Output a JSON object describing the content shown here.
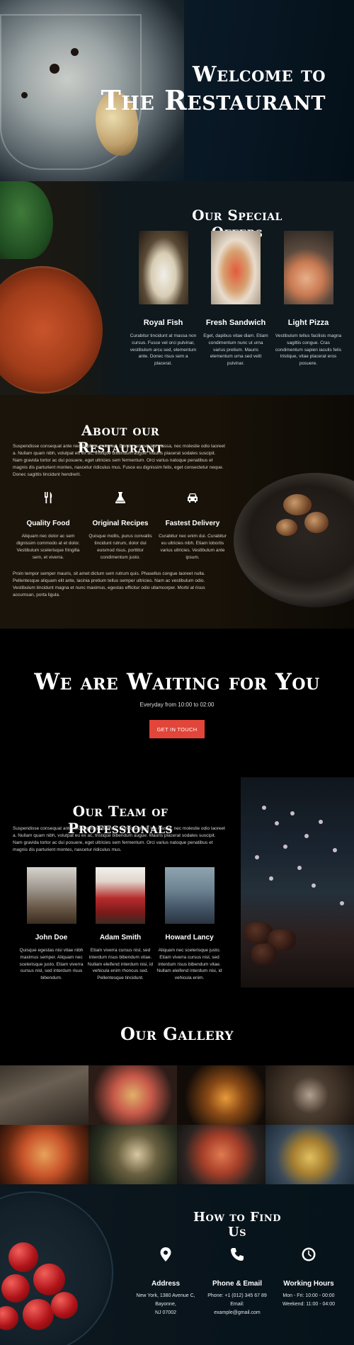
{
  "hero": {
    "title_line1": "Welcome to",
    "title_line2": "The Restaurant"
  },
  "offers": {
    "title": "Our Special Offers",
    "items": [
      {
        "name": "Royal Fish",
        "text": "Curabitur tincidunt at massa non cursus. Fusce vel orci pulvinar, vestibulum arcu sed, elementum ante. Donec risus sem a placerat."
      },
      {
        "name": "Fresh Sandwich",
        "text": "Eget, dapibus vitae diam. Etiam condimentum nunc ut urna varius pretium. Mauris elementum urna sed velit pulvinar."
      },
      {
        "name": "Light Pizza",
        "text": "Vestibulum tellus facilisis magna sagittis congue. Cras condimentum sapien iaculis felis tristique, vitae placerat eros posuere."
      }
    ]
  },
  "about": {
    "title": "About our Restaurant",
    "intro": "Suspendisse consequat ante nec dapibus euismod. Donec semper leo massa, nec molestie odio laoreet a. Nullam quam nibh, volutpat eu ex ac, tristique bibendum augue. Mauris placerat sodales suscipit. Nam gravida tortor ac dui posuere, eget ultricies sem fermentum. Orci varius natoque penatibus et magnis dis parturient montes, nascetur ridiculus mus. Fusce eu dignissim felis, eget consectetur neque. Donec sagittis tincidunt hendrerit.",
    "features": [
      {
        "icon": "utensils-icon",
        "name": "Quality Food",
        "text": "Aliquam nec dolor ac sem dignissim commodo at et dolor. Vestibulum scelerisque fringilla sem, et viverra."
      },
      {
        "icon": "flask-icon",
        "name": "Original Recipes",
        "text": "Quisque mollis, purus convallis tincidunt rutrum, dolor dui euismod risus, porttitor condimentum justo."
      },
      {
        "icon": "car-icon",
        "name": "Fastest Delivery",
        "text": "Curabitur nec enim dui. Curabitur eu ultricies nibh. Etiam lobortis varius ultricies. Vestibulum ante ipsum."
      }
    ],
    "outro": "Proin tempor semper mauris, sit amet dictum sem rutrum quis. Phasellus congue laoreet nulla. Pellentesque aliquam elit ante, lacinia pretium tellus semper ultricies. Nam ac vestibulum odio. Vestibulum tincidunt magna et nunc maximus, egestas efficitur odio ullamcorper. Morbi at risus accumsan, porta ligula."
  },
  "waiting": {
    "title": "We are Waiting for You",
    "hours": "Everyday from 10:00 to 02:00",
    "cta_label": "GET IN TOUCH"
  },
  "team": {
    "title": "Our Team of Professionals",
    "intro": "Suspendisse consequat ante nec dapibus euismod. Donec semper leo massa, nec molestie odio laoreet a. Nullam quam nibh, volutpat eu ex ac, tristique bibendum augue. Mauris placerat sodales suscipit. Nam gravida tortor ac dui posuere, eget ultricies sem fermentum. Orci varius natoque penatibus et magnis dis parturient montes, nascetur ridiculus mus.",
    "members": [
      {
        "name": "John Doe",
        "text": "Quisque egestas nisi vitae nibh maximus semper. Aliquam nec scelerisque justo. Etiam viverra cursus nisl, sed interdum risus bibendum."
      },
      {
        "name": "Adam Smith",
        "text": "Etiam viverra cursus nisl, sed interdum risus bibendum vitae. Nullam eleifend interdum nisi, id vehicula enim rhoncus sed. Pellentesque tincidunt."
      },
      {
        "name": "Howard Lancy",
        "text": "Aliquam nec scelerisque justo. Etiam viverra cursus nisl, sed interdum risus bibendum vitae. Nullam eleifend interdum nisi, id vehicula enim."
      }
    ]
  },
  "gallery": {
    "title": "Our Gallery"
  },
  "findus": {
    "title": "How to Find Us",
    "items": [
      {
        "icon": "map-pin-icon",
        "name": "Address",
        "lines": [
          "New York, 1380 Avenue C,",
          "Bayonne,",
          "NJ 07002"
        ]
      },
      {
        "icon": "phone-icon",
        "name": "Phone & Email",
        "lines": [
          "Phone: +1 (012) 345 67 89",
          "Email:",
          "example@gmail.com"
        ]
      },
      {
        "icon": "clock-icon",
        "name": "Working Hours",
        "lines": [
          "Mon - Fri: 10:00 - 00:00",
          "Weekend: 11:00 - 04:00",
          ""
        ]
      }
    ]
  },
  "colors": {
    "accent": "#e2453a",
    "dark_bg": "#000000",
    "offers_bg": "#0e181d",
    "about_bg": "#1a140b"
  }
}
